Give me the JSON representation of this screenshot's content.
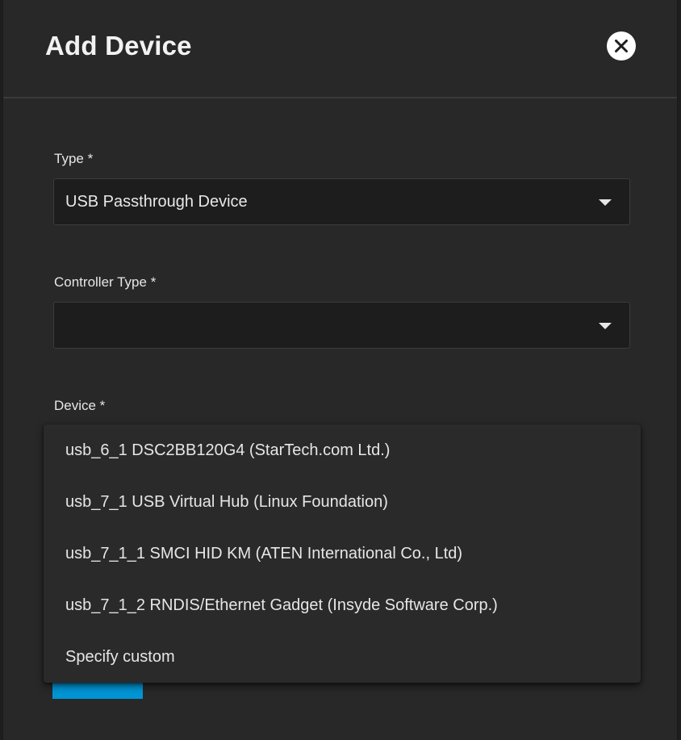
{
  "dialog": {
    "title": "Add Device",
    "close_icon": "close-circle-icon"
  },
  "form": {
    "type": {
      "label": "Type *",
      "value": "USB Passthrough Device"
    },
    "controller_type": {
      "label": "Controller Type *",
      "value": ""
    },
    "device": {
      "label": "Device *",
      "options": [
        "usb_6_1 DSC2BB120G4 (StarTech.com Ltd.)",
        "usb_7_1 USB Virtual Hub (Linux Foundation)",
        "usb_7_1_1 SMCI HID KM (ATEN International Co., Ltd)",
        "usb_7_1_2 RNDIS/Ethernet Gadget (Insyde Software Corp.)",
        "Specify custom"
      ]
    }
  },
  "colors": {
    "panel_bg": "#282828",
    "field_bg": "#1d1d1d",
    "accent": "#0095d5",
    "text": "#e6e6e6"
  }
}
